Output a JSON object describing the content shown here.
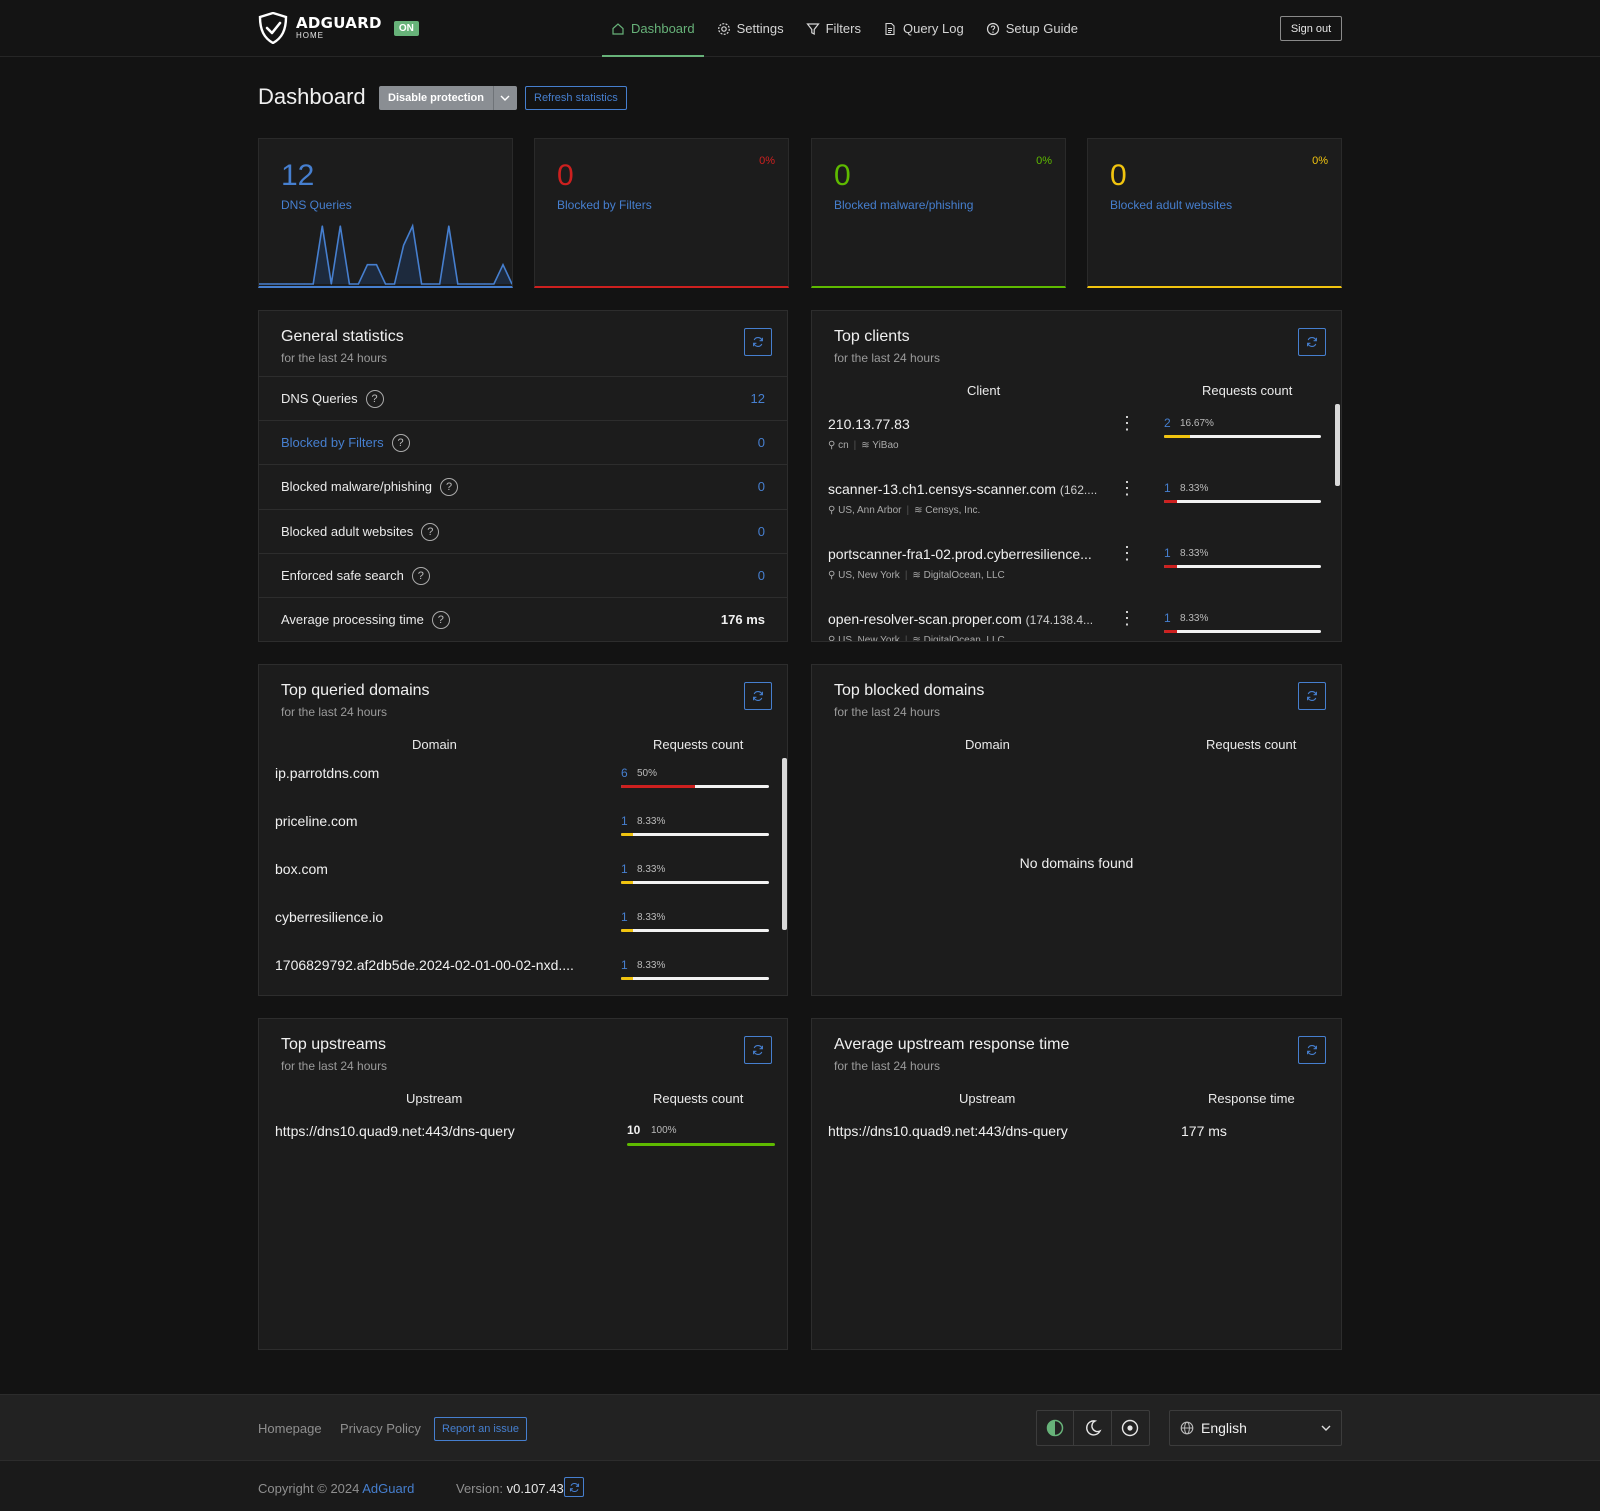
{
  "header": {
    "logo_main": "ADGUARD",
    "logo_sub": "HOME",
    "status_badge": "ON",
    "nav": [
      {
        "label": "Dashboard",
        "icon": "home-icon",
        "active": true
      },
      {
        "label": "Settings",
        "icon": "gear-icon"
      },
      {
        "label": "Filters",
        "icon": "filter-icon"
      },
      {
        "label": "Query Log",
        "icon": "document-icon"
      },
      {
        "label": "Setup Guide",
        "icon": "help-circle-icon"
      }
    ],
    "signout": "Sign out"
  },
  "page": {
    "title": "Dashboard",
    "disable_protection": "Disable protection",
    "refresh_statistics": "Refresh statistics"
  },
  "stat_cards": [
    {
      "value": "12",
      "label": "DNS Queries",
      "percent": "",
      "color": "#467fcf"
    },
    {
      "value": "0",
      "label": "Blocked by Filters",
      "percent": "0%",
      "color": "#cd201f"
    },
    {
      "value": "0",
      "label": "Blocked malware/phishing",
      "percent": "0%",
      "color": "#5eba00"
    },
    {
      "value": "0",
      "label": "Blocked adult websites",
      "percent": "0%",
      "color": "#f1c40f"
    }
  ],
  "chart_data": {
    "type": "area",
    "title": "",
    "series": [
      {
        "values": [
          0,
          0,
          0,
          0,
          0,
          0,
          0,
          3,
          0,
          3,
          0,
          0,
          1,
          1,
          0,
          0,
          2,
          3,
          0,
          0,
          0,
          3,
          0,
          0,
          0,
          0,
          0,
          1,
          0
        ]
      }
    ],
    "ylim": [
      0,
      3
    ],
    "grid": false,
    "colors": {
      "line": "#467fcf",
      "fill": "#1d2a3d"
    }
  },
  "general_stats": {
    "title": "General statistics",
    "subtitle": "for the last 24 hours",
    "rows": [
      {
        "name": "DNS Queries",
        "value": "12"
      },
      {
        "name": "Blocked by Filters",
        "value": "0"
      },
      {
        "name": "Blocked malware/phishing",
        "value": "0"
      },
      {
        "name": "Blocked adult websites",
        "value": "0"
      },
      {
        "name": "Enforced safe search",
        "value": "0"
      },
      {
        "name": "Average processing time",
        "value": "176 ms"
      }
    ],
    "help_glyph": "?"
  },
  "top_clients": {
    "title": "Top clients",
    "subtitle": "for the last 24 hours",
    "col_client": "Client",
    "col_requests": "Requests count",
    "rows": [
      {
        "name": "210.13.77.83",
        "ip": "",
        "location": "cn",
        "org": "YiBao",
        "count": "2",
        "percent": "16.67%",
        "share": 0.1667,
        "color": "#f1c40f"
      },
      {
        "name": "scanner-13.ch1.censys-scanner.com",
        "ip": "(162....",
        "location": "US, Ann Arbor",
        "org": "Censys, Inc.",
        "count": "1",
        "percent": "8.33%",
        "share": 0.0833,
        "color": "#cd201f"
      },
      {
        "name": "portscanner-fra1-02.prod.cyberresilience...",
        "ip": "",
        "location": "US, New York",
        "org": "DigitalOcean, LLC",
        "count": "1",
        "percent": "8.33%",
        "share": 0.0833,
        "color": "#cd201f"
      },
      {
        "name": "open-resolver-scan.proper.com",
        "ip": "(174.138.4...",
        "location": "US, New York",
        "org": "DigitalOcean, LLC",
        "count": "1",
        "percent": "8.33%",
        "share": 0.0833,
        "color": "#cd201f"
      }
    ]
  },
  "top_queried": {
    "title": "Top queried domains",
    "subtitle": "for the last 24 hours",
    "col_domain": "Domain",
    "col_requests": "Requests count",
    "rows": [
      {
        "domain": "ip.parrotdns.com",
        "count": "6",
        "percent": "50%",
        "share": 0.5,
        "color": "#cd201f"
      },
      {
        "domain": "priceline.com",
        "count": "1",
        "percent": "8.33%",
        "share": 0.0833,
        "color": "#f1c40f"
      },
      {
        "domain": "box.com",
        "count": "1",
        "percent": "8.33%",
        "share": 0.0833,
        "color": "#f1c40f"
      },
      {
        "domain": "cyberresilience.io",
        "count": "1",
        "percent": "8.33%",
        "share": 0.0833,
        "color": "#f1c40f"
      },
      {
        "domain": "1706829792.af2db5de.2024-02-01-00-02-nxd....",
        "count": "1",
        "percent": "8.33%",
        "share": 0.0833,
        "color": "#f1c40f"
      }
    ]
  },
  "top_blocked": {
    "title": "Top blocked domains",
    "subtitle": "for the last 24 hours",
    "col_domain": "Domain",
    "col_requests": "Requests count",
    "empty": "No domains found"
  },
  "top_upstreams": {
    "title": "Top upstreams",
    "subtitle": "for the last 24 hours",
    "col_upstream": "Upstream",
    "col_requests": "Requests count",
    "rows": [
      {
        "upstream": "https://dns10.quad9.net:443/dns-query",
        "count": "10",
        "percent": "100%",
        "share": 1.0,
        "color": "#5eba00"
      }
    ]
  },
  "avg_upstream": {
    "title": "Average upstream response time",
    "subtitle": "for the last 24 hours",
    "col_upstream": "Upstream",
    "col_time": "Response time",
    "rows": [
      {
        "upstream": "https://dns10.quad9.net:443/dns-query",
        "time": "177 ms"
      }
    ]
  },
  "footer": {
    "homepage": "Homepage",
    "privacy": "Privacy Policy",
    "report": "Report an issue",
    "language": "English",
    "copyright_prefix": "Copyright © 2024",
    "copyright_brand": "AdGuard",
    "version_label": "Version:",
    "version": "v0.107.43"
  }
}
